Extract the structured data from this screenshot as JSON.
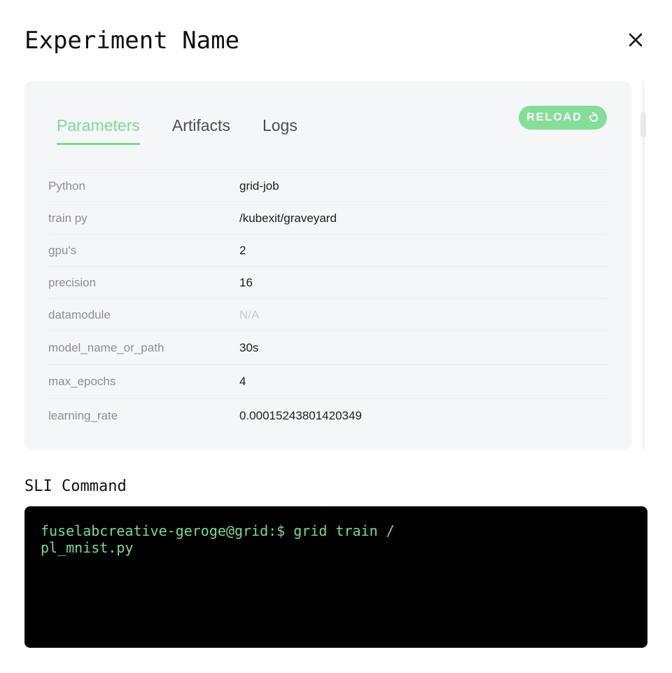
{
  "modal": {
    "title": "Experiment Name"
  },
  "tabs": [
    {
      "label": "Parameters",
      "active": true
    },
    {
      "label": "Artifacts",
      "active": false
    },
    {
      "label": "Logs",
      "active": false
    }
  ],
  "reload": {
    "label": "RELOAD",
    "icon": "refresh-icon"
  },
  "parameters": [
    {
      "key": "Python",
      "value": "grid-job"
    },
    {
      "key": "train py",
      "value": "/kubexit/graveyard"
    },
    {
      "key": "gpu's",
      "value": "2"
    },
    {
      "key": "precision",
      "value": "16"
    },
    {
      "key": "datamodule",
      "value": "N/A"
    },
    {
      "key": "model_name_or_path",
      "value": "30s"
    },
    {
      "key": "max_epochs",
      "value": "4"
    },
    {
      "key": "learning_rate",
      "value": "0.00015243801420349"
    }
  ],
  "sli": {
    "label": "SLI Command",
    "command": "fuselabcreative-geroge@grid:$ grid train /\npl_mnist.py"
  },
  "colors": {
    "accent": "#7cd992",
    "terminal_bg": "#000000"
  }
}
